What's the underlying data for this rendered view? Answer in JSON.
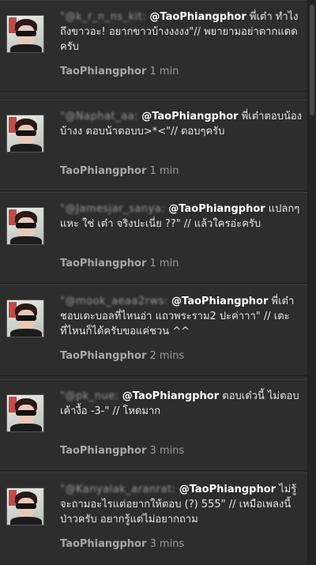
{
  "tweets": [
    {
      "blurred_name": "\"@k_r_n_ns_kit:",
      "mention": "@TaoPhiangphor",
      "text": " พี่เต๋า ทำไงถึงขาวอะ! อยากขาวบ้างงงงง\"// พยายามอย่าตากแดดครับ",
      "user": "TaoPhiangphor",
      "time": "1 min"
    },
    {
      "blurred_name": "\"@Naphat_aa:",
      "mention": "@TaoPhiangphor",
      "text": " พี่เต๋าตอบน้องบ้างง ตอบน้าตอบบ>*<\"// ตอบๆครับ",
      "user": "TaoPhiangphor",
      "time": "1 min"
    },
    {
      "blurred_name": "\"@Jamesjar_sanya:",
      "mention": "@TaoPhiangphor",
      "text": " แปลกๆแหะ ใช่ เต๋า จริงปะเนี่ย ??\" // แล้วใครอ่ะครับ",
      "user": "TaoPhiangphor",
      "time": "1 min"
    },
    {
      "blurred_name": "\"@mook_aeaa2rws:",
      "mention": "@TaoPhiangphor",
      "text": " พี่เต๋าชอบเตะบอลที่ไหนอ่า แถวพระราม2 ปะค่าาา\" // เตะที่ไหนก็ได้ครับขอแค่ชวน ^^",
      "user": "TaoPhiangphor",
      "time": "2 mins"
    },
    {
      "blurred_name": "\"@pk_nue:",
      "mention": "@TaoPhiangphor",
      "text": " ตอบเด๋วนี้ ไม่ตอบเค้างื้อ -3-\" // โหดมาก",
      "user": "TaoPhiangphor",
      "time": "3 mins"
    },
    {
      "blurred_name": "\"@Kanyalak_aranrat:",
      "mention": "@TaoPhiangphor",
      "text": " ไม่รู้จะถามอะไรแต่อยากให้ตอบ (?) 555\" // เหมือเพลงนี้ป่าวครับ อยากรู้แต่ไม่อยากถาม",
      "user": "TaoPhiangphor",
      "time": "3 mins"
    }
  ]
}
